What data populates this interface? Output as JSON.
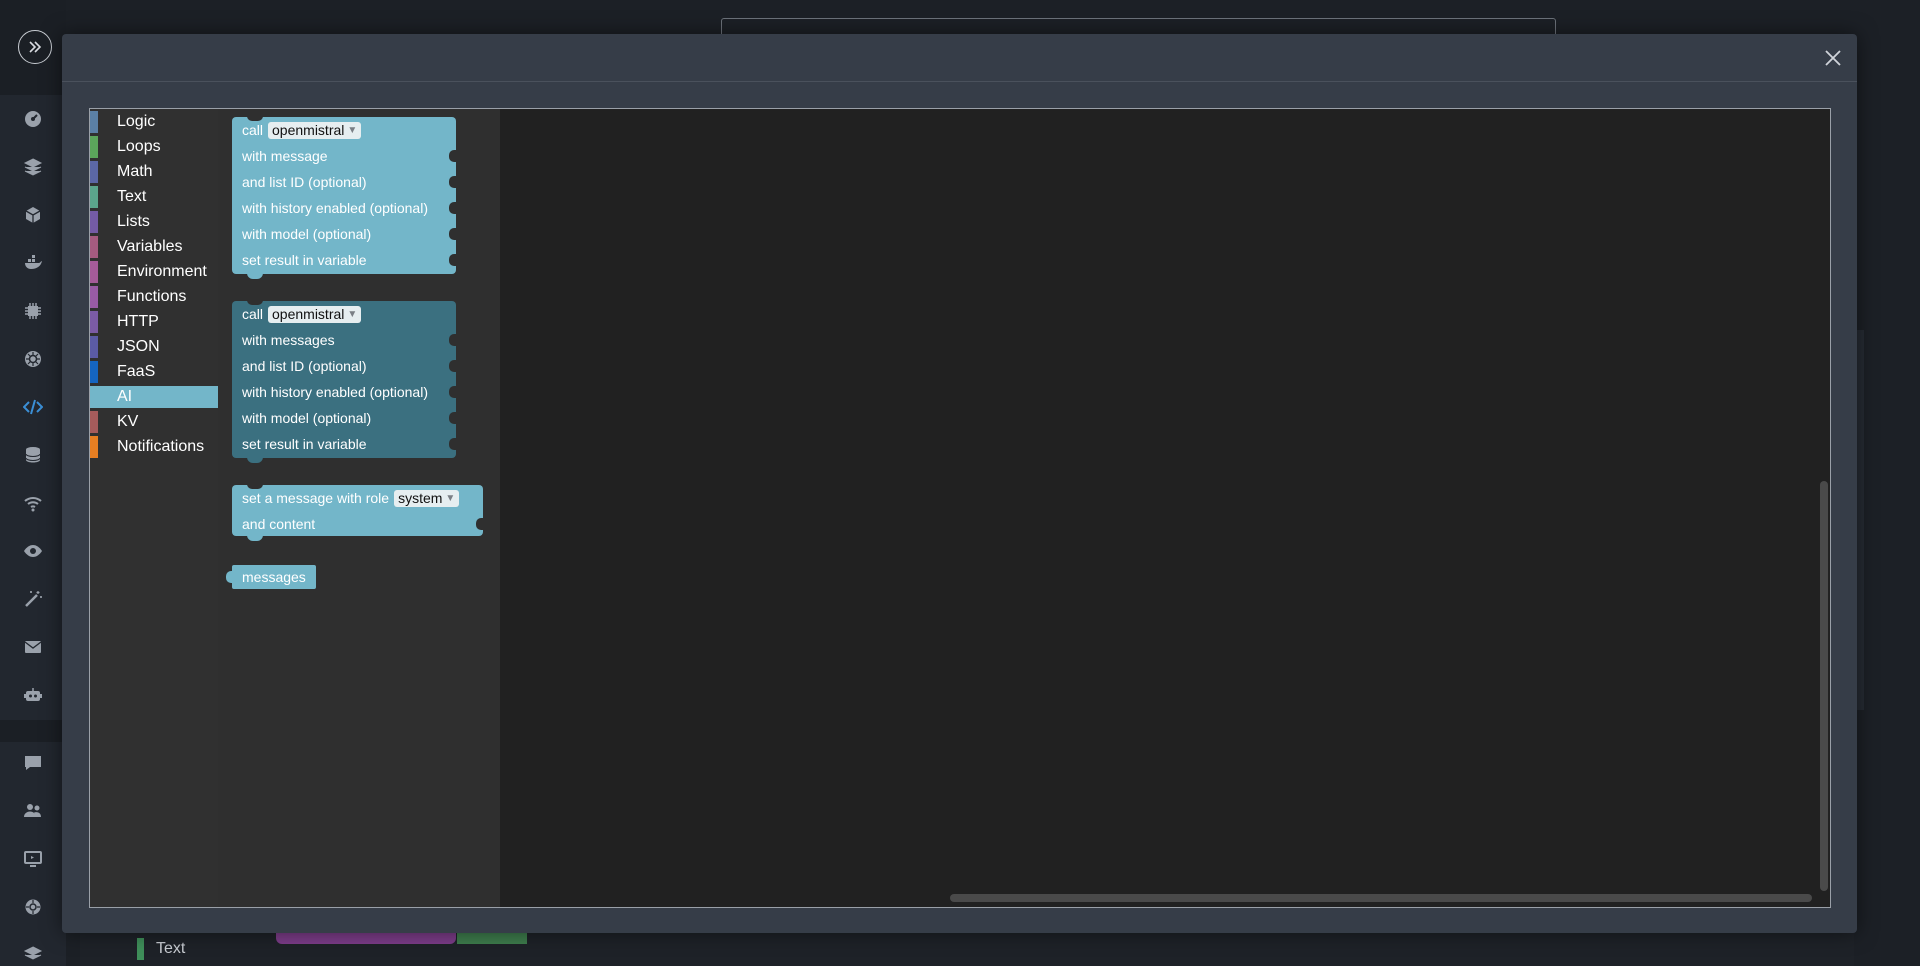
{
  "sidebar": {
    "icons": [
      "expand-icon",
      "dashboard-icon",
      "layers-icon",
      "box-icon",
      "docker-icon",
      "chip-icon",
      "kubernetes-icon",
      "code-icon",
      "database-icon",
      "wifi-icon",
      "eye-icon",
      "magic-wand-icon",
      "mail-icon",
      "robot-icon",
      "chat-icon",
      "users-icon",
      "screen-icon",
      "settings-icon",
      "stack-icon"
    ]
  },
  "background": {
    "under_category": "Text"
  },
  "toolbox": {
    "categories": [
      {
        "label": "Logic",
        "color": "#5b80a5"
      },
      {
        "label": "Loops",
        "color": "#5ba55b"
      },
      {
        "label": "Math",
        "color": "#5b67a5"
      },
      {
        "label": "Text",
        "color": "#5ba58c"
      },
      {
        "label": "Lists",
        "color": "#745ba5"
      },
      {
        "label": "Variables",
        "color": "#a55b80"
      },
      {
        "label": "Environment",
        "color": "#a55b99"
      },
      {
        "label": "Functions",
        "color": "#995ba5"
      },
      {
        "label": "HTTP",
        "color": "#7b5ba5"
      },
      {
        "label": "JSON",
        "color": "#5b5ba5"
      },
      {
        "label": "FaaS",
        "color": "#1565c0"
      },
      {
        "label": "AI",
        "color": "#73b6c9"
      },
      {
        "label": "KV",
        "color": "#a55b5b"
      },
      {
        "label": "Notifications",
        "color": "#e67e22"
      }
    ],
    "selected": "AI"
  },
  "blocks": {
    "block1": {
      "call": "call",
      "model": "openmistral",
      "rows": [
        "with message",
        "and list ID (optional)",
        "with history enabled (optional)",
        "with model (optional)",
        "set result in variable"
      ]
    },
    "block2": {
      "call": "call",
      "model": "openmistral",
      "rows": [
        "with messages",
        "and list ID (optional)",
        "with history enabled (optional)",
        "with model (optional)",
        "set result in variable"
      ]
    },
    "block3": {
      "label": "set a message with role",
      "role": "system",
      "row2": "and content"
    },
    "block4": {
      "label": "messages"
    }
  }
}
